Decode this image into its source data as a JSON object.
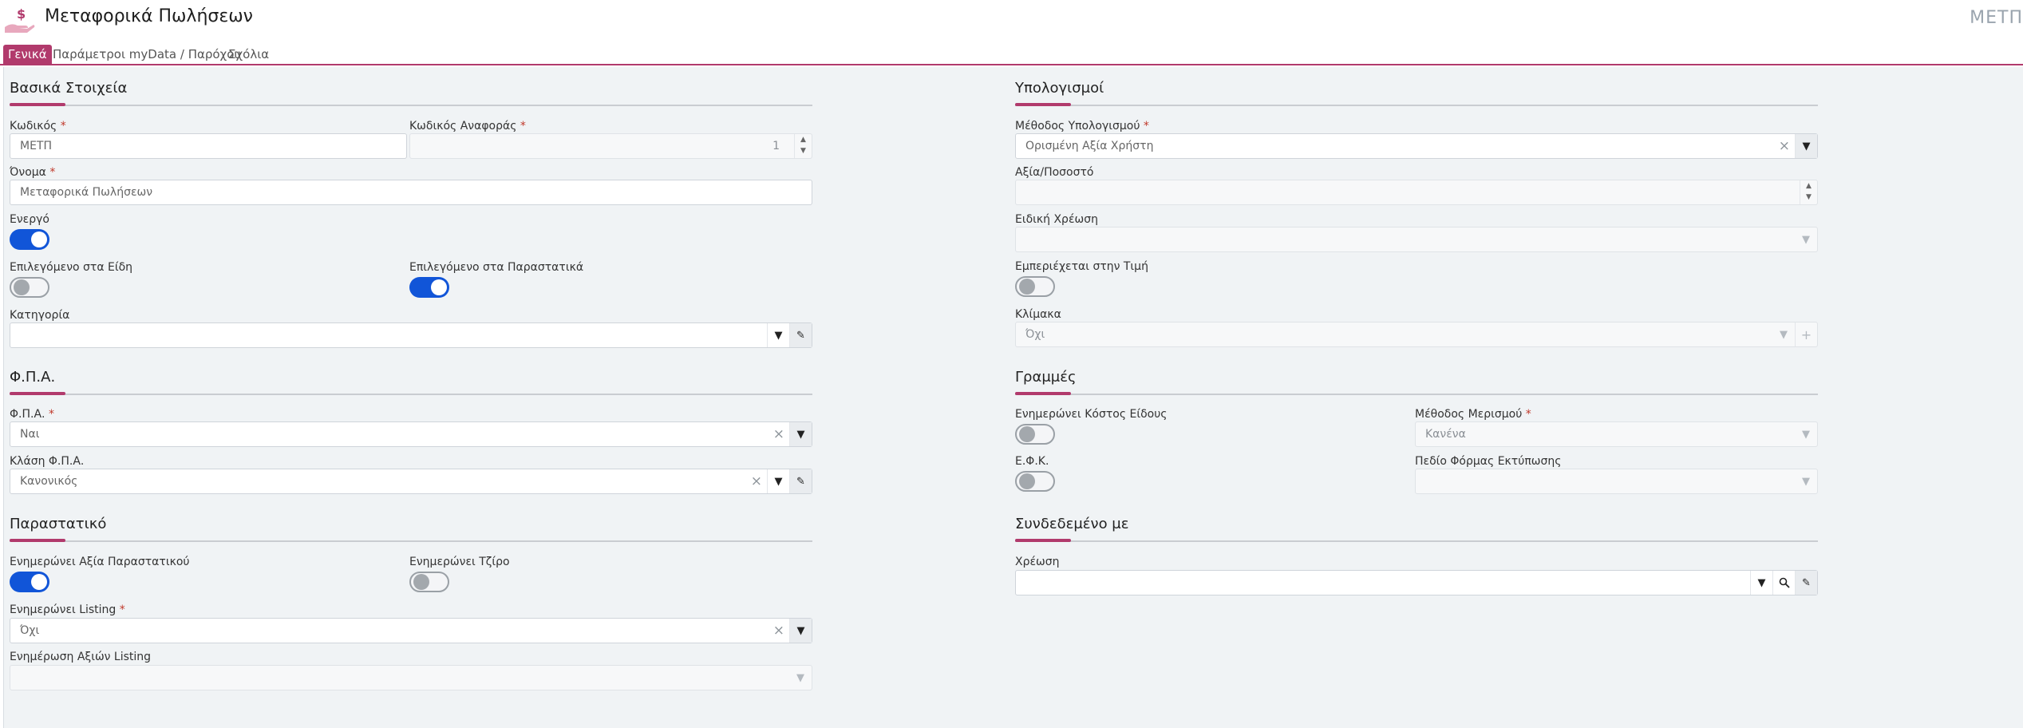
{
  "header": {
    "title": "Μεταφορικά Πωλήσεων",
    "code_right": "ΜΕΤΠ"
  },
  "tabs": [
    {
      "label": "Γενικά",
      "active": true
    },
    {
      "label": "Παράμετροι myData / Παρόχου",
      "active": false
    },
    {
      "label": "Σχόλια",
      "active": false
    }
  ],
  "basic": {
    "title": "Βασικά Στοιχεία",
    "code_label": "Κωδικός",
    "code_value": "ΜΕΤΠ",
    "ref_code_label": "Κωδικός Αναφοράς",
    "ref_code_value": "1",
    "name_label": "Όνομα",
    "name_value": "Μεταφορικά Πωλήσεων",
    "active_label": "Ενεργό",
    "active_value": true,
    "sel_items_label": "Επιλεγόμενο στα Είδη",
    "sel_items_value": false,
    "sel_docs_label": "Επιλεγόμενο στα Παραστατικά",
    "sel_docs_value": true,
    "category_label": "Κατηγορία",
    "category_value": ""
  },
  "vat": {
    "title": "Φ.Π.Α.",
    "vat_label": "Φ.Π.Α.",
    "vat_value": "Ναι",
    "vat_class_label": "Κλάση Φ.Π.Α.",
    "vat_class_value": "Κανονικός"
  },
  "document": {
    "title": "Παραστατικό",
    "upd_doc_value_label": "Ενημερώνει Αξία Παραστατικού",
    "upd_doc_value": true,
    "upd_turnover_label": "Ενημερώνει Τζίρο",
    "upd_turnover": false,
    "upd_listing_label": "Ενημερώνει Listing",
    "upd_listing_value": "Όχι",
    "listing_values_label": "Ενημέρωση Αξιών Listing",
    "listing_values_value": ""
  },
  "calc": {
    "title": "Υπολογισμοί",
    "method_label": "Μέθοδος Υπολογισμού",
    "method_value": "Ορισμένη Αξία Χρήστη",
    "amount_label": "Αξία/Ποσοστό",
    "amount_value": "",
    "special_label": "Ειδική Χρέωση",
    "special_value": "",
    "included_label": "Εμπεριέχεται στην Τιμή",
    "included_value": false,
    "scale_label": "Κλίμακα",
    "scale_value": "Όχι"
  },
  "lines": {
    "title": "Γραμμές",
    "upd_cost_label": "Ενημερώνει Κόστος Είδους",
    "upd_cost_value": false,
    "split_label": "Μέθοδος Μερισμού",
    "split_value": "Κανένα",
    "efk_label": "Ε.Φ.Κ.",
    "efk_value": false,
    "print_field_label": "Πεδίο Φόρμας Εκτύπωσης",
    "print_field_value": ""
  },
  "linked": {
    "title": "Συνδεδεμένο με",
    "charge_label": "Χρέωση",
    "charge_value": ""
  },
  "colors": {
    "accent": "#b13a6c",
    "toggle_on": "#1155d8"
  },
  "icons": {
    "app": "hand-dollar-icon",
    "dropdown": "caret-down-icon",
    "edit": "pencil-icon",
    "search": "magnifier-icon",
    "clear": "close-icon",
    "add": "plus-icon"
  }
}
